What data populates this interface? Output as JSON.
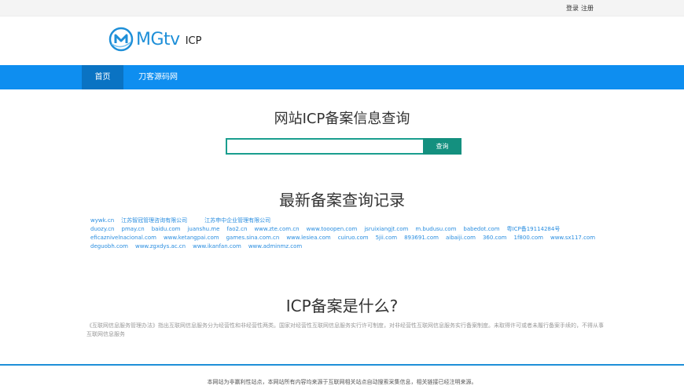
{
  "topbar": {
    "login": "登录",
    "register": "注册"
  },
  "brand": {
    "logo_text": "MGtv",
    "logo_sub": "ICP",
    "accent": "#1e8fd8"
  },
  "nav": {
    "home": "首页",
    "link2": "刀客源码网",
    "bar_color": "#0e8ef0"
  },
  "hero": {
    "title": "网站ICP备案信息查询",
    "search_placeholder": "",
    "search_button": "查询"
  },
  "recent": {
    "title": "最新备案查询记录",
    "rows": [
      [
        "wywk.cn",
        "江苏智冠管理咨询有限公司",
        "江苏申中企业管理有限公司"
      ],
      [
        "duozy.cn",
        "pmay.cn",
        "baidu.com",
        "juanshu.me",
        "fao2.cn",
        "www.zte.com.cn",
        "www.tooopen.com",
        "jsruixiangjt.com",
        "m.budusu.com",
        "babedot.com",
        "粤ICP备19114284号"
      ],
      [
        "eficaznivelnacional.com",
        "www.ketangpai.com",
        "games.sina.com.cn",
        "www.lesiea.com",
        "cuiruo.com",
        "5jii.com",
        "893691.com",
        "aibaiji.com",
        "360.com",
        "1f800.com",
        "www.sx117.com"
      ],
      [
        "deguobh.com",
        "www.zgxdys.ac.cn",
        "www.ikanfan.com",
        "www.adminmz.com"
      ]
    ]
  },
  "about": {
    "title": "ICP备案是什么?",
    "desc": "《互联网信息服务管理办法》指出互联网信息服务分为经营性和非经营性两类。国家对经营性互联网信息服务实行许可制度，对非经营性互联网信息服务实行备案制度。未取得许可或者未履行备案手续的，不得从事互联网信息服务"
  },
  "footer": {
    "text": "本网站为非赢利性站点，本网站所有内容均来源于互联网相关站点自动搜索采集信息，相关链接已经注明来源。"
  }
}
